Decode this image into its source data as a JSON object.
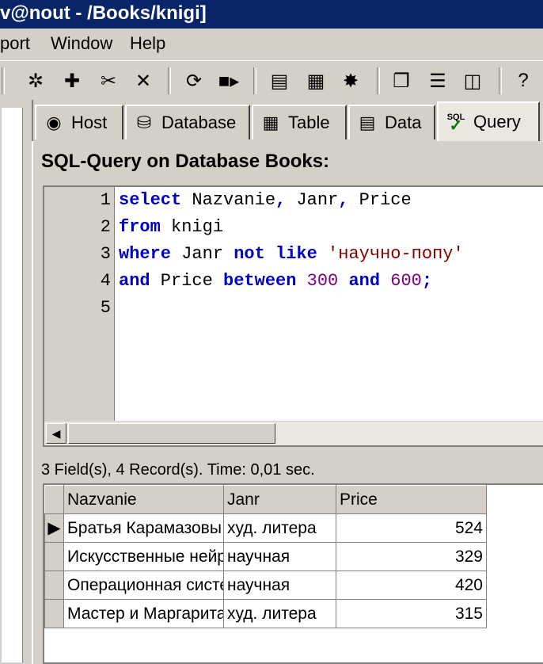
{
  "window": {
    "title": "v@nout - /Books/knigi]"
  },
  "menu": {
    "items": [
      "port",
      "Window",
      "Help"
    ]
  },
  "toolbar": {
    "icons": [
      "connect-icon",
      "new-icon",
      "cut-icon",
      "close-icon",
      "refresh-icon",
      "run-icon",
      "query-icon",
      "report-icon",
      "settings-icon",
      "cascade-icon",
      "tile-horizontal-icon",
      "tile-vertical-icon",
      "help-icon"
    ]
  },
  "tabs": [
    {
      "label": "Host",
      "icon": "host-icon"
    },
    {
      "label": "Database",
      "icon": "database-icon"
    },
    {
      "label": "Table",
      "icon": "table-icon"
    },
    {
      "label": "Data",
      "icon": "data-icon"
    },
    {
      "label": "Query",
      "icon": "sql-icon",
      "badge": "SQL"
    }
  ],
  "query": {
    "header": "SQL-Query on Database Books:",
    "line_numbers": [
      "1",
      "2",
      "3",
      "4",
      "5"
    ],
    "lines": [
      [
        {
          "t": "select",
          "c": "kw"
        },
        {
          "t": " Nazvanie",
          "c": "plain"
        },
        {
          "t": ",",
          "c": "kw"
        },
        {
          "t": " Janr",
          "c": "plain"
        },
        {
          "t": ",",
          "c": "kw"
        },
        {
          "t": " Price",
          "c": "plain"
        }
      ],
      [
        {
          "t": "from",
          "c": "kw"
        },
        {
          "t": " knigi",
          "c": "plain"
        }
      ],
      [
        {
          "t": "where",
          "c": "kw"
        },
        {
          "t": " Janr ",
          "c": "plain"
        },
        {
          "t": "not like",
          "c": "kw"
        },
        {
          "t": " 'научно-попу'",
          "c": "str"
        }
      ],
      [
        {
          "t": "and",
          "c": "kw"
        },
        {
          "t": " Price ",
          "c": "plain"
        },
        {
          "t": "between",
          "c": "kw"
        },
        {
          "t": " 300 ",
          "c": "num"
        },
        {
          "t": "and",
          "c": "kw"
        },
        {
          "t": " 600",
          "c": "num"
        },
        {
          "t": ";",
          "c": "kw"
        }
      ],
      []
    ]
  },
  "result": {
    "status": "3 Field(s), 4 Record(s). Time: 0,01 sec.",
    "columns": [
      "Nazvanie",
      "Janr",
      "Price"
    ],
    "rows": [
      [
        "Братья Карамазовы",
        "худ. литера",
        "524"
      ],
      [
        "Искусственные нейр",
        "научная",
        "329"
      ],
      [
        "Операционная систе",
        "научная",
        "420"
      ],
      [
        "Мастер и Маргарита",
        "худ. литера",
        "315"
      ]
    ],
    "current_row_indicator": "▶"
  }
}
